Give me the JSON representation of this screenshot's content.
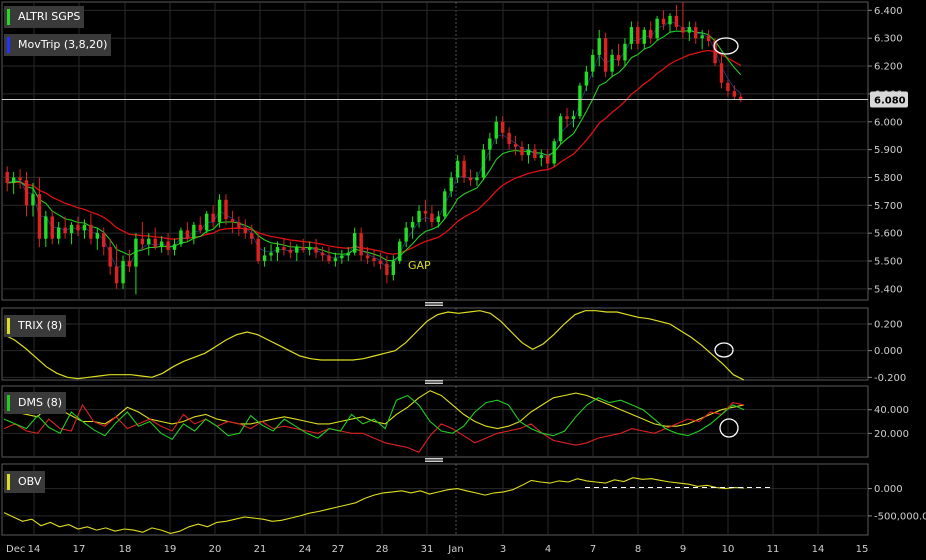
{
  "chart_data": {
    "type": "candlestick-chart",
    "colors": {
      "up": "#22dd22",
      "down": "#dd2222",
      "doji": "#3377ff",
      "fast_ma": "#22cc22",
      "slow_ma": "#dd1111",
      "trix": "#dddd22",
      "dms_plus": "#22cc22",
      "dms_minus": "#dd2222",
      "dms_adx": "#dddd22",
      "obv": "#dddd22",
      "grid": "#2a2a2a"
    },
    "panels": [
      {
        "id": "price",
        "ylim": [
          5.36,
          6.43
        ],
        "ticks": [
          "5.400",
          "5.500",
          "5.600",
          "5.700",
          "5.800",
          "5.900",
          "6.000",
          "6.100",
          "6.200",
          "6.300",
          "6.400"
        ],
        "legend": [
          {
            "label": "ALTRI SGPS",
            "color": "#22dd22"
          },
          {
            "label": "MovTrip (3,8,20)",
            "color": "#2233ff"
          }
        ],
        "last_price": "6.080",
        "annotation": "GAP"
      },
      {
        "id": "trix",
        "ylim": [
          -0.22,
          0.32
        ],
        "ticks": [
          "0.200",
          "0.000",
          "-0.200"
        ],
        "legend": [
          {
            "label": "TRIX (8)",
            "color": "#dddd22"
          }
        ]
      },
      {
        "id": "dms",
        "ylim": [
          0,
          60
        ],
        "ticks": [
          "40.000",
          "20.000"
        ],
        "legend": [
          {
            "label": "DMS (8)",
            "color": "#22cc22"
          }
        ]
      },
      {
        "id": "obv",
        "ylim": [
          -850000,
          450000
        ],
        "ticks": [
          "0.000",
          "-500,000.0"
        ],
        "legend": [
          {
            "label": "OBV",
            "color": "#dddd22"
          }
        ]
      }
    ],
    "x_labels": [
      "Dec",
      "14",
      "17",
      "18",
      "19",
      "20",
      "21",
      "24",
      "27",
      "28",
      "31",
      "Jan",
      "3",
      "4",
      "7",
      "8",
      "9",
      "10",
      "11",
      "14",
      "15"
    ],
    "candles": [
      {
        "o": 5.82,
        "h": 5.84,
        "l": 5.75,
        "c": 5.78
      },
      {
        "o": 5.78,
        "h": 5.82,
        "l": 5.74,
        "c": 5.8
      },
      {
        "o": 5.8,
        "h": 5.83,
        "l": 5.76,
        "c": 5.79
      },
      {
        "o": 5.79,
        "h": 5.82,
        "l": 5.66,
        "c": 5.7
      },
      {
        "o": 5.7,
        "h": 5.78,
        "l": 5.66,
        "c": 5.74
      },
      {
        "o": 5.74,
        "h": 5.8,
        "l": 5.55,
        "c": 5.58
      },
      {
        "o": 5.58,
        "h": 5.68,
        "l": 5.55,
        "c": 5.66
      },
      {
        "o": 5.66,
        "h": 5.68,
        "l": 5.56,
        "c": 5.58
      },
      {
        "o": 5.58,
        "h": 5.64,
        "l": 5.56,
        "c": 5.62
      },
      {
        "o": 5.62,
        "h": 5.66,
        "l": 5.58,
        "c": 5.6
      },
      {
        "o": 5.6,
        "h": 5.64,
        "l": 5.56,
        "c": 5.63
      },
      {
        "o": 5.63,
        "h": 5.66,
        "l": 5.59,
        "c": 5.61
      },
      {
        "o": 5.61,
        "h": 5.65,
        "l": 5.58,
        "c": 5.63
      },
      {
        "o": 5.63,
        "h": 5.67,
        "l": 5.56,
        "c": 5.58
      },
      {
        "o": 5.58,
        "h": 5.62,
        "l": 5.54,
        "c": 5.6
      },
      {
        "o": 5.6,
        "h": 5.62,
        "l": 5.52,
        "c": 5.55
      },
      {
        "o": 5.55,
        "h": 5.58,
        "l": 5.45,
        "c": 5.48
      },
      {
        "o": 5.48,
        "h": 5.56,
        "l": 5.4,
        "c": 5.42
      },
      {
        "o": 5.42,
        "h": 5.52,
        "l": 5.4,
        "c": 5.5
      },
      {
        "o": 5.5,
        "h": 5.54,
        "l": 5.46,
        "c": 5.48
      },
      {
        "o": 5.48,
        "h": 5.6,
        "l": 5.38,
        "c": 5.58
      },
      {
        "o": 5.58,
        "h": 5.64,
        "l": 5.54,
        "c": 5.56
      },
      {
        "o": 5.56,
        "h": 5.6,
        "l": 5.52,
        "c": 5.58
      },
      {
        "o": 5.58,
        "h": 5.62,
        "l": 5.54,
        "c": 5.55
      },
      {
        "o": 5.55,
        "h": 5.59,
        "l": 5.53,
        "c": 5.57
      },
      {
        "o": 5.57,
        "h": 5.6,
        "l": 5.52,
        "c": 5.54
      },
      {
        "o": 5.54,
        "h": 5.58,
        "l": 5.52,
        "c": 5.56
      },
      {
        "o": 5.56,
        "h": 5.62,
        "l": 5.55,
        "c": 5.61
      },
      {
        "o": 5.61,
        "h": 5.64,
        "l": 5.57,
        "c": 5.58
      },
      {
        "o": 5.58,
        "h": 5.64,
        "l": 5.56,
        "c": 5.63
      },
      {
        "o": 5.63,
        "h": 5.66,
        "l": 5.6,
        "c": 5.61
      },
      {
        "o": 5.61,
        "h": 5.68,
        "l": 5.6,
        "c": 5.67
      },
      {
        "o": 5.67,
        "h": 5.7,
        "l": 5.62,
        "c": 5.64
      },
      {
        "o": 5.64,
        "h": 5.74,
        "l": 5.62,
        "c": 5.72
      },
      {
        "o": 5.72,
        "h": 5.74,
        "l": 5.63,
        "c": 5.65
      },
      {
        "o": 5.65,
        "h": 5.68,
        "l": 5.6,
        "c": 5.64
      },
      {
        "o": 5.64,
        "h": 5.66,
        "l": 5.59,
        "c": 5.62
      },
      {
        "o": 5.62,
        "h": 5.65,
        "l": 5.58,
        "c": 5.6
      },
      {
        "o": 5.6,
        "h": 5.63,
        "l": 5.56,
        "c": 5.58
      },
      {
        "o": 5.58,
        "h": 5.6,
        "l": 5.49,
        "c": 5.5
      },
      {
        "o": 5.5,
        "h": 5.55,
        "l": 5.48,
        "c": 5.52
      },
      {
        "o": 5.52,
        "h": 5.56,
        "l": 5.5,
        "c": 5.53
      },
      {
        "o": 5.53,
        "h": 5.57,
        "l": 5.5,
        "c": 5.55
      },
      {
        "o": 5.55,
        "h": 5.58,
        "l": 5.52,
        "c": 5.54
      },
      {
        "o": 5.54,
        "h": 5.57,
        "l": 5.51,
        "c": 5.53
      },
      {
        "o": 5.53,
        "h": 5.56,
        "l": 5.5,
        "c": 5.55
      },
      {
        "o": 5.55,
        "h": 5.58,
        "l": 5.53,
        "c": 5.54
      },
      {
        "o": 5.54,
        "h": 5.57,
        "l": 5.52,
        "c": 5.55
      },
      {
        "o": 5.55,
        "h": 5.58,
        "l": 5.51,
        "c": 5.53
      },
      {
        "o": 5.53,
        "h": 5.55,
        "l": 5.5,
        "c": 5.52
      },
      {
        "o": 5.52,
        "h": 5.55,
        "l": 5.49,
        "c": 5.5
      },
      {
        "o": 5.5,
        "h": 5.53,
        "l": 5.48,
        "c": 5.51
      },
      {
        "o": 5.51,
        "h": 5.54,
        "l": 5.49,
        "c": 5.52
      },
      {
        "o": 5.52,
        "h": 5.55,
        "l": 5.5,
        "c": 5.53
      },
      {
        "o": 5.53,
        "h": 5.62,
        "l": 5.52,
        "c": 5.6
      },
      {
        "o": 5.6,
        "h": 5.62,
        "l": 5.5,
        "c": 5.52
      },
      {
        "o": 5.52,
        "h": 5.55,
        "l": 5.49,
        "c": 5.51
      },
      {
        "o": 5.51,
        "h": 5.54,
        "l": 5.48,
        "c": 5.5
      },
      {
        "o": 5.5,
        "h": 5.53,
        "l": 5.47,
        "c": 5.49
      },
      {
        "o": 5.49,
        "h": 5.52,
        "l": 5.42,
        "c": 5.45
      },
      {
        "o": 5.45,
        "h": 5.52,
        "l": 5.43,
        "c": 5.5
      },
      {
        "o": 5.5,
        "h": 5.58,
        "l": 5.49,
        "c": 5.57
      },
      {
        "o": 5.57,
        "h": 5.64,
        "l": 5.55,
        "c": 5.62
      },
      {
        "o": 5.62,
        "h": 5.66,
        "l": 5.58,
        "c": 5.64
      },
      {
        "o": 5.64,
        "h": 5.7,
        "l": 5.62,
        "c": 5.68
      },
      {
        "o": 5.68,
        "h": 5.72,
        "l": 5.64,
        "c": 5.67
      },
      {
        "o": 5.67,
        "h": 5.7,
        "l": 5.62,
        "c": 5.64
      },
      {
        "o": 5.64,
        "h": 5.68,
        "l": 5.62,
        "c": 5.66
      },
      {
        "o": 5.66,
        "h": 5.76,
        "l": 5.65,
        "c": 5.75
      },
      {
        "o": 5.75,
        "h": 5.82,
        "l": 5.73,
        "c": 5.8
      },
      {
        "o": 5.8,
        "h": 5.88,
        "l": 5.78,
        "c": 5.86
      },
      {
        "o": 5.86,
        "h": 5.88,
        "l": 5.78,
        "c": 5.8
      },
      {
        "o": 5.8,
        "h": 5.83,
        "l": 5.77,
        "c": 5.79
      },
      {
        "o": 5.79,
        "h": 5.82,
        "l": 5.77,
        "c": 5.8
      },
      {
        "o": 5.8,
        "h": 5.92,
        "l": 5.79,
        "c": 5.9
      },
      {
        "o": 5.9,
        "h": 5.96,
        "l": 5.86,
        "c": 5.94
      },
      {
        "o": 5.94,
        "h": 6.02,
        "l": 5.92,
        "c": 6.0
      },
      {
        "o": 6.0,
        "h": 6.02,
        "l": 5.94,
        "c": 5.96
      },
      {
        "o": 5.96,
        "h": 5.98,
        "l": 5.9,
        "c": 5.92
      },
      {
        "o": 5.92,
        "h": 5.95,
        "l": 5.88,
        "c": 5.91
      },
      {
        "o": 5.91,
        "h": 5.93,
        "l": 5.86,
        "c": 5.88
      },
      {
        "o": 5.88,
        "h": 5.92,
        "l": 5.85,
        "c": 5.9
      },
      {
        "o": 5.9,
        "h": 5.92,
        "l": 5.86,
        "c": 5.87
      },
      {
        "o": 5.87,
        "h": 5.9,
        "l": 5.84,
        "c": 5.88
      },
      {
        "o": 5.88,
        "h": 5.9,
        "l": 5.83,
        "c": 5.85
      },
      {
        "o": 5.85,
        "h": 5.94,
        "l": 5.84,
        "c": 5.93
      },
      {
        "o": 5.93,
        "h": 6.03,
        "l": 5.92,
        "c": 6.02
      },
      {
        "o": 6.02,
        "h": 6.05,
        "l": 5.98,
        "c": 6.01
      },
      {
        "o": 6.01,
        "h": 6.04,
        "l": 5.98,
        "c": 6.02
      },
      {
        "o": 6.02,
        "h": 6.14,
        "l": 6.01,
        "c": 6.13
      },
      {
        "o": 6.13,
        "h": 6.2,
        "l": 6.11,
        "c": 6.18
      },
      {
        "o": 6.18,
        "h": 6.26,
        "l": 6.16,
        "c": 6.24
      },
      {
        "o": 6.24,
        "h": 6.33,
        "l": 6.2,
        "c": 6.3
      },
      {
        "o": 6.3,
        "h": 6.32,
        "l": 6.16,
        "c": 6.18
      },
      {
        "o": 6.18,
        "h": 6.26,
        "l": 6.16,
        "c": 6.24
      },
      {
        "o": 6.24,
        "h": 6.28,
        "l": 6.2,
        "c": 6.22
      },
      {
        "o": 6.22,
        "h": 6.3,
        "l": 6.2,
        "c": 6.28
      },
      {
        "o": 6.28,
        "h": 6.36,
        "l": 6.26,
        "c": 6.34
      },
      {
        "o": 6.34,
        "h": 6.36,
        "l": 6.26,
        "c": 6.28
      },
      {
        "o": 6.28,
        "h": 6.34,
        "l": 6.26,
        "c": 6.33
      },
      {
        "o": 6.33,
        "h": 6.36,
        "l": 6.28,
        "c": 6.3
      },
      {
        "o": 6.3,
        "h": 6.38,
        "l": 6.29,
        "c": 6.37
      },
      {
        "o": 6.37,
        "h": 6.4,
        "l": 6.33,
        "c": 6.35
      },
      {
        "o": 6.35,
        "h": 6.39,
        "l": 6.32,
        "c": 6.38
      },
      {
        "o": 6.38,
        "h": 6.42,
        "l": 6.33,
        "c": 6.34
      },
      {
        "o": 6.34,
        "h": 6.43,
        "l": 6.3,
        "c": 6.32
      },
      {
        "o": 6.32,
        "h": 6.36,
        "l": 6.29,
        "c": 6.34
      },
      {
        "o": 6.34,
        "h": 6.36,
        "l": 6.28,
        "c": 6.3
      },
      {
        "o": 6.3,
        "h": 6.33,
        "l": 6.26,
        "c": 6.31
      },
      {
        "o": 6.31,
        "h": 6.33,
        "l": 6.27,
        "c": 6.29
      },
      {
        "o": 6.29,
        "h": 6.3,
        "l": 6.2,
        "c": 6.21
      },
      {
        "o": 6.21,
        "h": 6.24,
        "l": 6.12,
        "c": 6.14
      },
      {
        "o": 6.14,
        "h": 6.15,
        "l": 6.09,
        "c": 6.11
      },
      {
        "o": 6.11,
        "h": 6.13,
        "l": 6.08,
        "c": 6.09
      },
      {
        "o": 6.09,
        "h": 6.1,
        "l": 6.07,
        "c": 6.08
      }
    ],
    "trix": [
      0.12,
      0.08,
      0.02,
      -0.05,
      -0.12,
      -0.17,
      -0.2,
      -0.21,
      -0.2,
      -0.19,
      -0.18,
      -0.18,
      -0.18,
      -0.19,
      -0.2,
      -0.17,
      -0.12,
      -0.08,
      -0.05,
      -0.02,
      0.03,
      0.08,
      0.12,
      0.14,
      0.12,
      0.08,
      0.04,
      0.0,
      -0.04,
      -0.06,
      -0.07,
      -0.07,
      -0.07,
      -0.07,
      -0.06,
      -0.04,
      -0.02,
      0.0,
      0.06,
      0.14,
      0.22,
      0.27,
      0.29,
      0.28,
      0.29,
      0.3,
      0.28,
      0.22,
      0.14,
      0.06,
      0.01,
      0.05,
      0.12,
      0.2,
      0.27,
      0.3,
      0.3,
      0.29,
      0.29,
      0.27,
      0.25,
      0.24,
      0.22,
      0.2,
      0.15,
      0.1,
      0.04,
      -0.03,
      -0.1,
      -0.18,
      -0.22
    ],
    "dms_plus": [
      32,
      28,
      24,
      35,
      25,
      20,
      38,
      30,
      23,
      18,
      29,
      38,
      26,
      30,
      20,
      15,
      28,
      22,
      32,
      26,
      18,
      20,
      35,
      27,
      22,
      32,
      26,
      20,
      16,
      24,
      22,
      36,
      28,
      32,
      24,
      48,
      52,
      44,
      30,
      22,
      20,
      26,
      38,
      46,
      48,
      44,
      30,
      24,
      20,
      18,
      22,
      34,
      44,
      50,
      46,
      48,
      44,
      40,
      32,
      24,
      20,
      18,
      22,
      28,
      36,
      44,
      40
    ],
    "dms_minus": [
      24,
      28,
      22,
      20,
      32,
      24,
      22,
      44,
      30,
      26,
      34,
      24,
      28,
      32,
      26,
      22,
      36,
      28,
      32,
      26,
      30,
      28,
      24,
      30,
      24,
      26,
      24,
      22,
      20,
      24,
      22,
      20,
      20,
      16,
      12,
      10,
      8,
      4,
      18,
      28,
      24,
      18,
      12,
      16,
      20,
      22,
      24,
      28,
      20,
      14,
      12,
      10,
      12,
      16,
      18,
      20,
      24,
      22,
      20,
      24,
      28,
      32,
      30,
      38,
      36,
      46,
      44
    ],
    "dms_adx": [
      40,
      38,
      36,
      34,
      44,
      40,
      35,
      30,
      30,
      28,
      34,
      42,
      38,
      32,
      30,
      28,
      30,
      34,
      36,
      32,
      30,
      28,
      28,
      30,
      32,
      34,
      32,
      30,
      28,
      28,
      30,
      32,
      34,
      30,
      28,
      36,
      42,
      50,
      56,
      52,
      44,
      36,
      30,
      26,
      24,
      26,
      30,
      38,
      44,
      50,
      52,
      54,
      52,
      48,
      44,
      40,
      36,
      32,
      28,
      26,
      26,
      28,
      32,
      36,
      40,
      42,
      44
    ],
    "obv": [
      -440000,
      -520000,
      -600000,
      -560000,
      -680000,
      -620000,
      -700000,
      -660000,
      -740000,
      -700000,
      -760000,
      -720000,
      -780000,
      -740000,
      -760000,
      -800000,
      -720000,
      -760000,
      -820000,
      -780000,
      -700000,
      -650000,
      -700000,
      -620000,
      -600000,
      -560000,
      -520000,
      -540000,
      -560000,
      -600000,
      -580000,
      -540000,
      -500000,
      -450000,
      -420000,
      -380000,
      -340000,
      -300000,
      -260000,
      -180000,
      -120000,
      -80000,
      -60000,
      -40000,
      -80000,
      -40000,
      -100000,
      -60000,
      -20000,
      0,
      -40000,
      -80000,
      -120000,
      -80000,
      -60000,
      -20000,
      60000,
      150000,
      120000,
      100000,
      140000,
      120000,
      180000,
      140000,
      120000,
      100000,
      160000,
      130000,
      200000,
      170000,
      180000,
      150000,
      120000,
      100000,
      80000,
      40000,
      60000,
      20000,
      0,
      20000,
      10000
    ],
    "obv_reference": 20000
  }
}
